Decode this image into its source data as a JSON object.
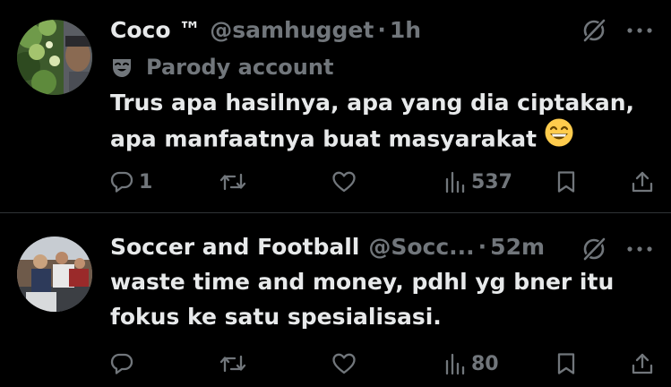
{
  "tweets": [
    {
      "display_name": "Coco ™",
      "handle": "@samhugget",
      "separator": "·",
      "time": "1h",
      "label": "Parody account",
      "lines": [
        "Trus apa hasilnya, apa yang dia ciptakan,",
        "apa manfaatnya buat masyarakat"
      ],
      "replies": "1",
      "retweets": "",
      "likes": "",
      "views": "537"
    },
    {
      "display_name": "Soccer and Football",
      "handle": "@Socc...",
      "separator": "·",
      "time": "52m",
      "lines": [
        "waste time and money, pdhl yg bner itu",
        "fokus ke satu spesialisasi."
      ],
      "replies": "",
      "retweets": "",
      "likes": "",
      "views": "80"
    }
  ],
  "icons": {
    "reply": "reply-icon",
    "retweet": "retweet-icon",
    "like": "like-icon",
    "views": "views-icon",
    "bookmark": "bookmark-icon",
    "share": "share-icon",
    "grok": "grok-icon",
    "more": "more-icon",
    "parody": "mask-icon",
    "emoji": "grinning-face-emoji"
  },
  "colors": {
    "background": "#000000",
    "text": "#e7e9ea",
    "secondary": "#71767b",
    "divider": "#2f3336",
    "emoji": "#ffcc4d"
  }
}
